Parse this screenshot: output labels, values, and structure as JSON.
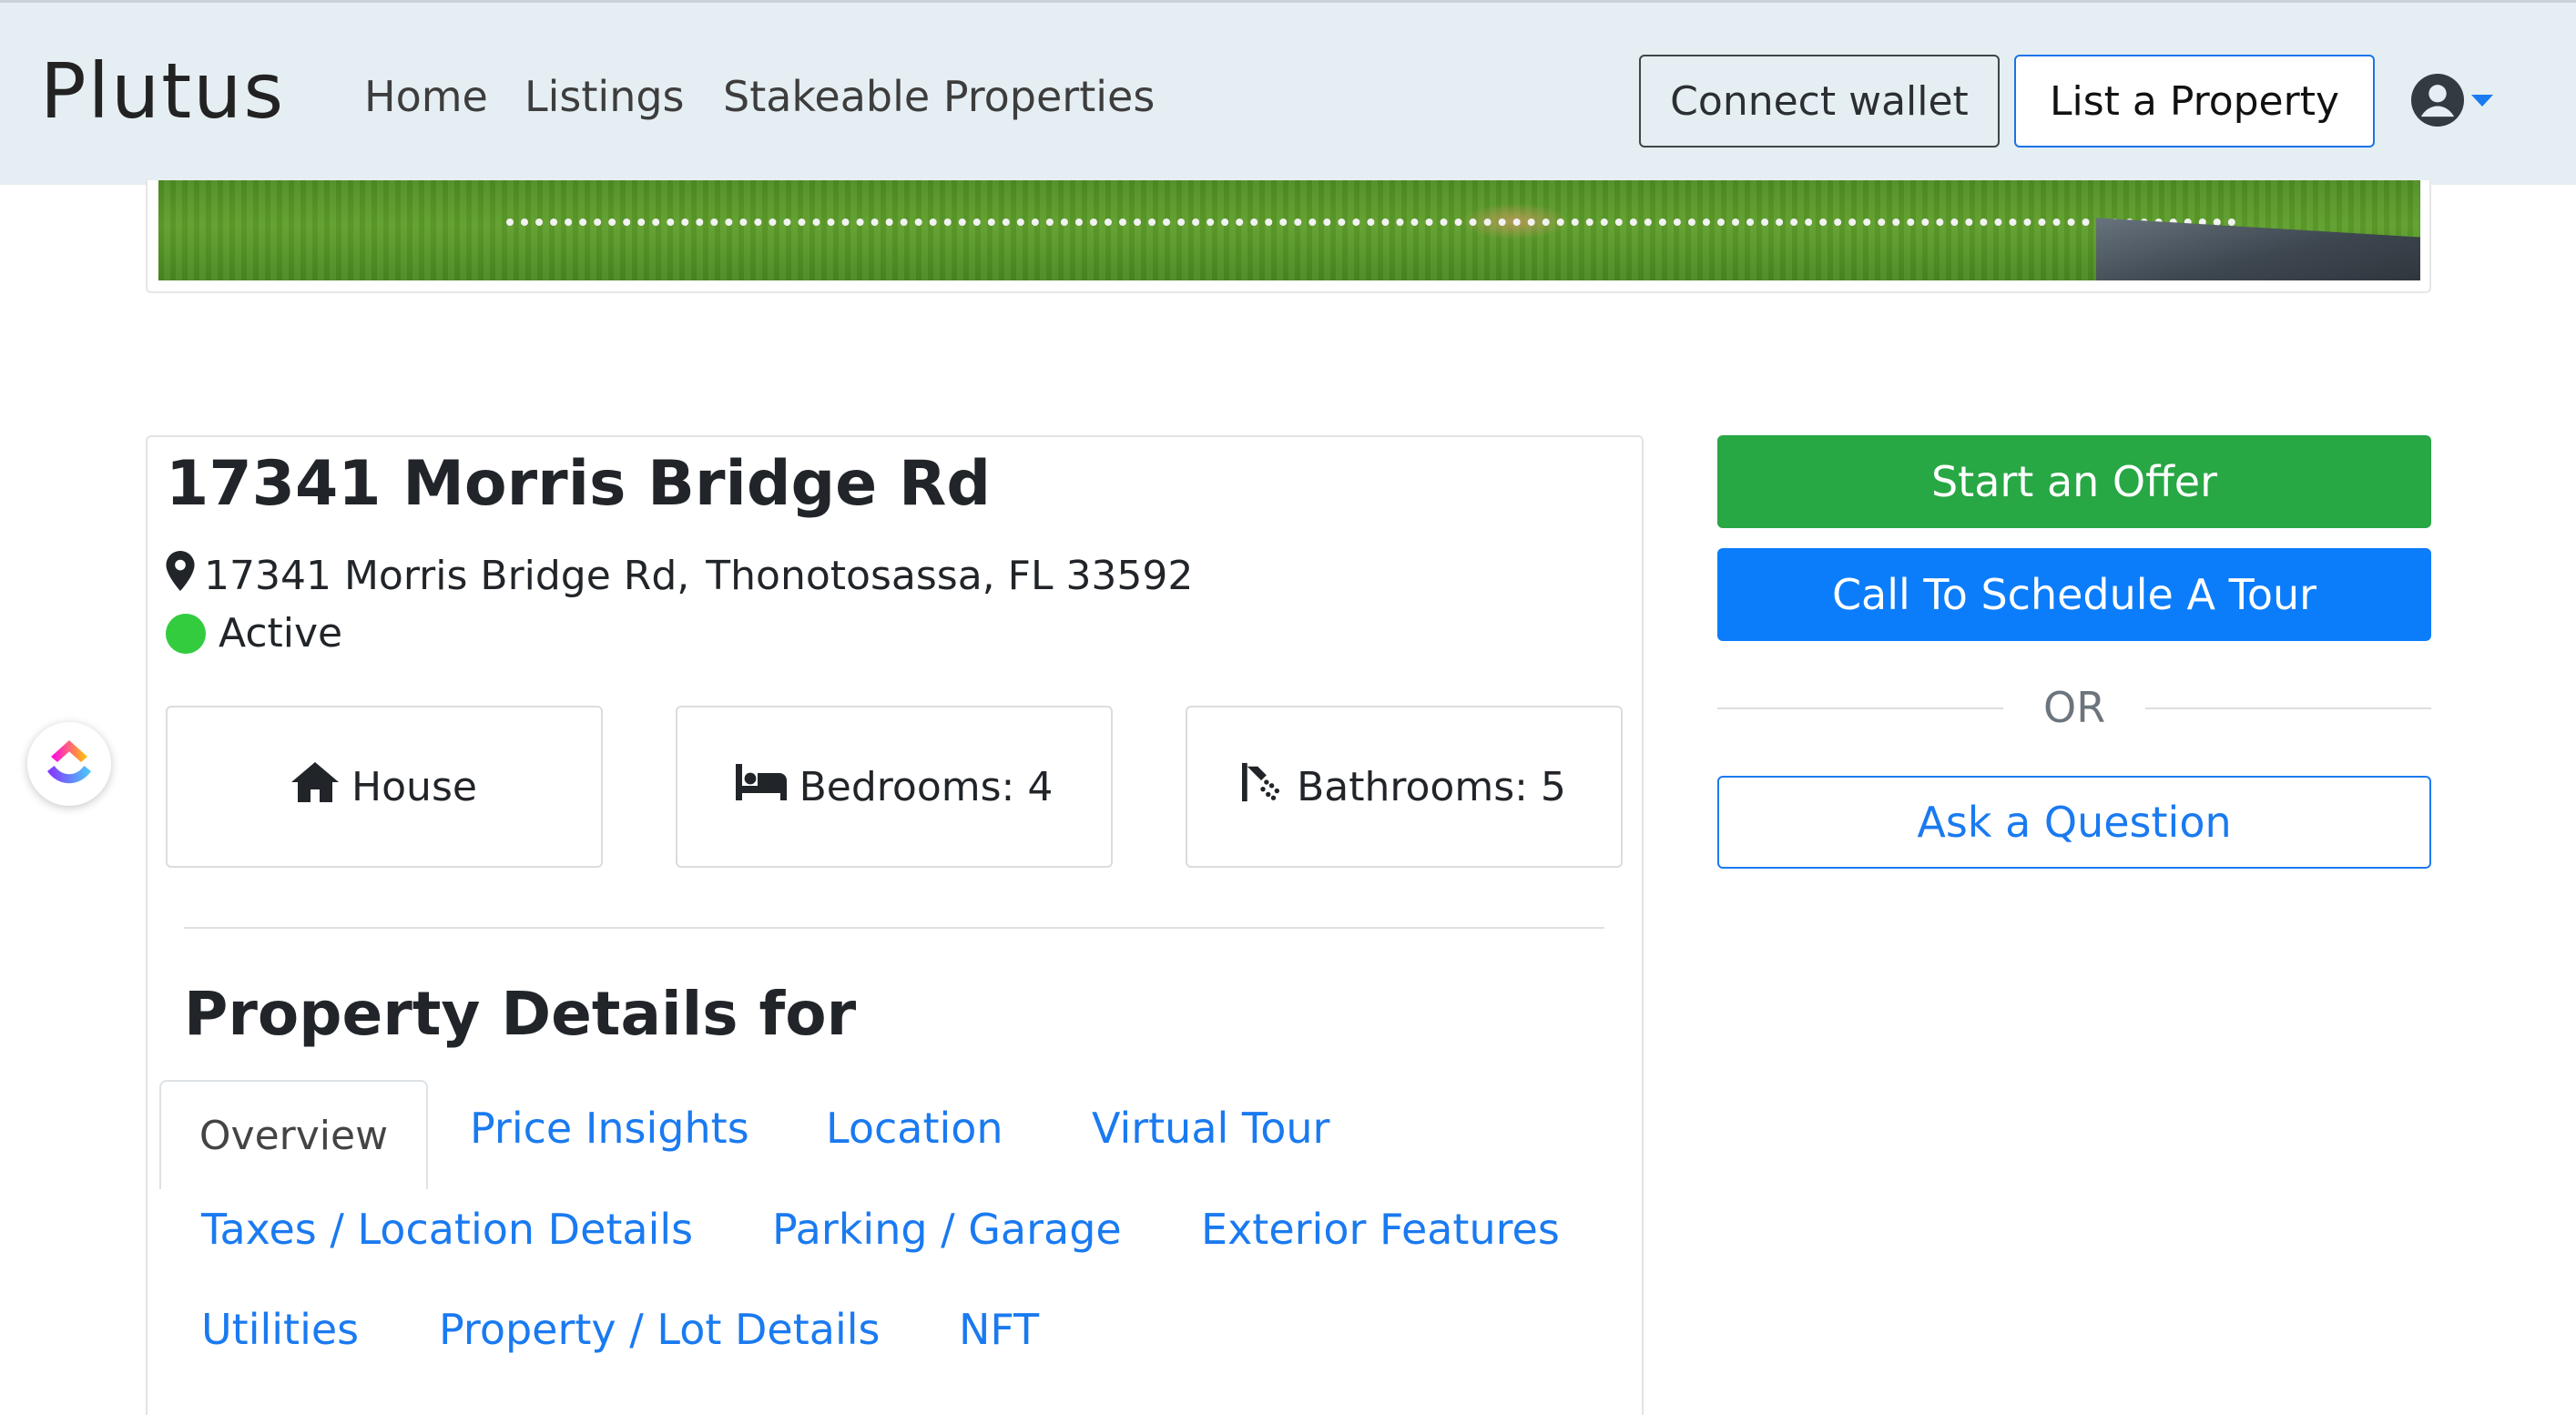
{
  "navbar": {
    "brand": "Plutus",
    "links": [
      "Home",
      "Listings",
      "Stakeable Properties"
    ],
    "connect_wallet": "Connect wallet",
    "list_property": "List a Property",
    "user_icon": "user-circle-icon",
    "caret_icon": "caret-down-icon"
  },
  "property": {
    "title": "17341 Morris Bridge Rd",
    "street": "17341 Morris Bridge Rd,",
    "city_state_zip": "Thonotosassa, FL 33592",
    "status": "Active",
    "status_color": "#33cc3f",
    "features": {
      "type": "House",
      "bedrooms": "Bedrooms: 4",
      "bathrooms": "Bathrooms: 5"
    }
  },
  "details": {
    "heading": "Property Details for",
    "tabs": [
      "Overview",
      "Price Insights",
      "Location",
      "Virtual Tour",
      "Taxes / Location Details",
      "Parking / Garage",
      "Exterior Features",
      "Utilities",
      "Property / Lot Details",
      "NFT"
    ],
    "active_tab": "Overview"
  },
  "actions": {
    "start_offer": "Start an Offer",
    "schedule_tour": "Call To Schedule A Tour",
    "or": "OR",
    "ask_question": "Ask a Question"
  },
  "colors": {
    "navbar_bg": "#e5eef2",
    "offer_green": "#28a745",
    "tour_blue": "#0b7dfb",
    "link_blue": "#1a7af0"
  }
}
